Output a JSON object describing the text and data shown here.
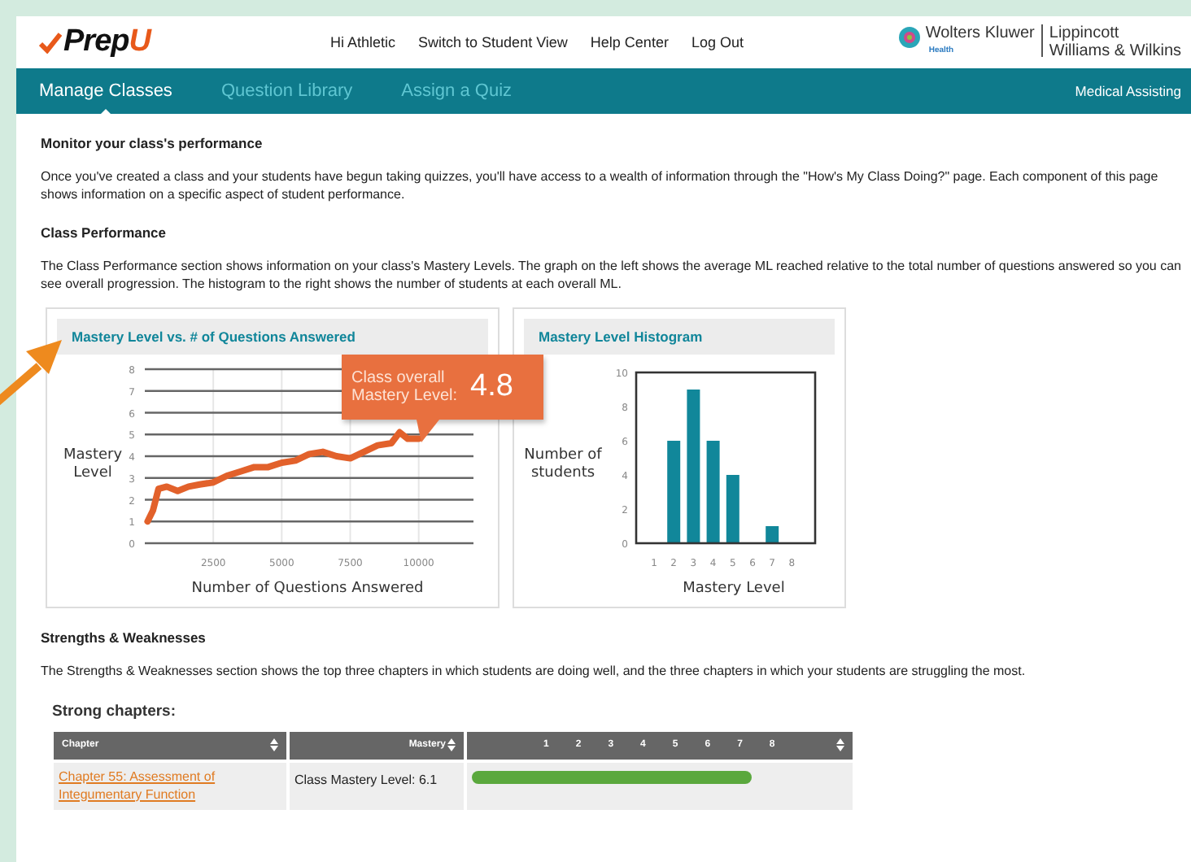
{
  "header": {
    "logo": {
      "text": "Prep",
      "accent": "U"
    },
    "links": [
      "Hi Athletic",
      "Switch to Student View",
      "Help Center",
      "Log Out"
    ],
    "publisher": {
      "name": "Wolters Kluwer",
      "division": "Health",
      "imprint": [
        "Lippincott",
        "Williams & Wilkins"
      ]
    }
  },
  "nav": {
    "tabs": [
      {
        "label": "Manage Classes",
        "selected": true
      },
      {
        "label": "Question Library",
        "selected": false
      },
      {
        "label": "Assign a Quiz",
        "selected": false
      }
    ],
    "course": "Medical Assisting"
  },
  "sections": [
    {
      "heading": "Monitor your class's performance",
      "text": "Once you've created a class and your students have begun taking quizzes, you'll have access to a wealth of information through the \"How's My Class Doing?\" page. Each component of this page shows information on a specific aspect of student performance."
    },
    {
      "heading": "Class Performance",
      "text": "The Class Performance section shows information on your class's Mastery Levels. The graph on the left shows the average ML reached relative to the total number of questions answered so you can see overall progression. The histogram to the right shows the number of students at each overall ML."
    }
  ],
  "charts": [
    {
      "title": "Mastery Level vs. # of Questions Answered",
      "chart_data": {
        "type": "line",
        "xlabel": "Number of Questions Answered",
        "ylabel": "Mastery Level",
        "x": [
          100,
          300,
          500,
          800,
          1200,
          1600,
          2000,
          2500,
          3000,
          3500,
          4000,
          4500,
          5000,
          5500,
          6000,
          6500,
          7000,
          7500,
          8000,
          8500,
          9000,
          9300,
          9600,
          10000
        ],
        "series": [
          {
            "color": "#e2612b",
            "values": [
              1.0,
              1.5,
              2.5,
              2.6,
              2.4,
              2.6,
              2.7,
              2.8,
              3.1,
              3.3,
              3.5,
              3.5,
              3.7,
              3.8,
              4.1,
              4.2,
              4.0,
              3.9,
              4.2,
              4.5,
              4.6,
              5.1,
              4.8,
              4.8
            ]
          }
        ],
        "xlim": [
          0,
          12000
        ],
        "ylim": [
          0,
          8
        ],
        "xticks": [
          2500,
          5000,
          7500,
          10000
        ],
        "yticks": [
          0,
          1,
          2,
          3,
          4,
          5,
          6,
          7,
          8
        ],
        "grid": true
      }
    },
    {
      "title": "Mastery Level Histogram",
      "chart_data": {
        "type": "bar",
        "xlabel": "Mastery Level",
        "ylabel": "Number of students",
        "categories": [
          "1",
          "2",
          "3",
          "4",
          "5",
          "6",
          "7",
          "8"
        ],
        "values": [
          0,
          6,
          9,
          6,
          4,
          0,
          1,
          0
        ],
        "ylim": [
          0,
          10
        ],
        "yticks": [
          0,
          2,
          4,
          6,
          8,
          10
        ]
      }
    }
  ],
  "callout": {
    "label": [
      "Class overall",
      "Mastery Level:"
    ],
    "value": "4.8"
  },
  "strengths": {
    "heading": "Strengths & Weaknesses",
    "text": "The Strengths & Weaknesses section shows the top three chapters in which students are doing well, and the three chapters in which your students are struggling the most.",
    "subheading": "Strong chapters:",
    "table": {
      "columns": [
        "Chapter",
        "Mastery"
      ],
      "scale": [
        "1",
        "2",
        "3",
        "4",
        "5",
        "6",
        "7",
        "8"
      ],
      "rows": [
        {
          "chapter": "Chapter 55: Assessment of Integumentary Function",
          "mastery": "Class Mastery Level: 6.1",
          "level": 0.7625
        }
      ]
    }
  }
}
